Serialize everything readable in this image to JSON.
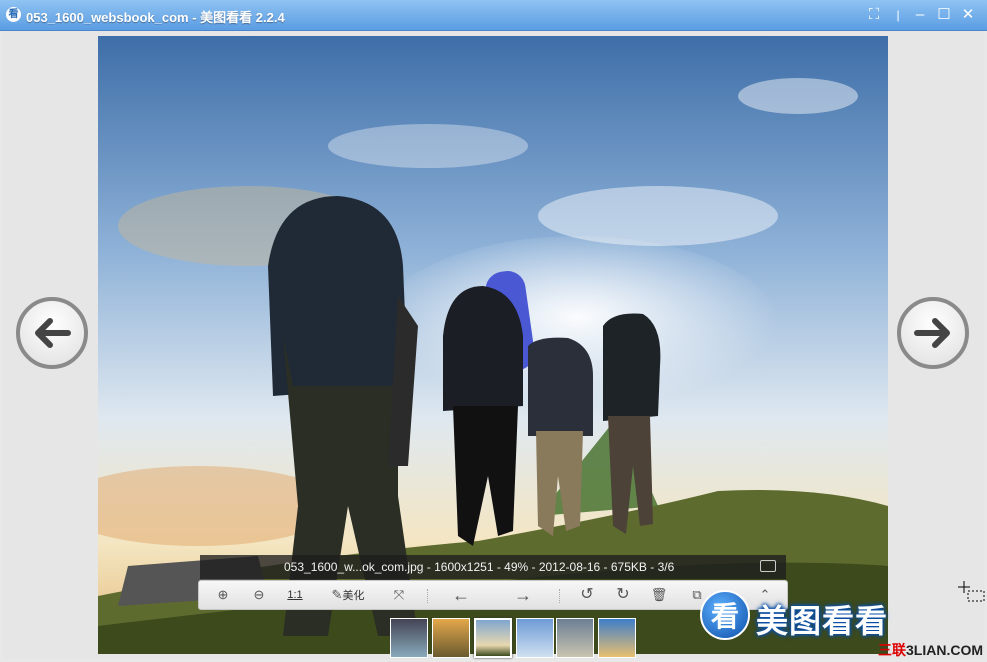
{
  "window": {
    "app_icon_glyph": "看",
    "title": "053_1600_websbook_com - 美图看看 2.2.4",
    "buttons": [
      {
        "name": "fullscreen-button",
        "glyph": "⛶"
      },
      {
        "name": "minimize-button",
        "glyph": "–"
      },
      {
        "name": "maximize-button",
        "glyph": "☐"
      },
      {
        "name": "close-button",
        "glyph": "✕"
      }
    ]
  },
  "info": {
    "text": "053_1600_w...ok_com.jpg - 1600x1251 - 49% - 2012-08-16 - 675KB - 3/6"
  },
  "toolbar": {
    "zoom_in": "⊕",
    "zoom_out": "⊖",
    "actual_size": "1:1",
    "beautify_label": "美化",
    "fit": "⤧",
    "prev": "←",
    "next": "→",
    "rotate_left": "↺",
    "rotate_right": "↻",
    "delete": "🗑",
    "copy": "⧉",
    "more": "⌃"
  },
  "thumbnails": [
    "thumb-1",
    "thumb-2",
    "thumb-3",
    "thumb-4",
    "thumb-5",
    "thumb-6"
  ],
  "brand": {
    "glyph": "看",
    "text": "美图看看"
  },
  "watermark": {
    "part1": "三联",
    "part2": "3LIAN.COM"
  },
  "colors": {
    "titlebar_top": "#8fc3f2",
    "titlebar_bottom": "#5b9de3",
    "brand_blue": "#0a4fa8"
  }
}
